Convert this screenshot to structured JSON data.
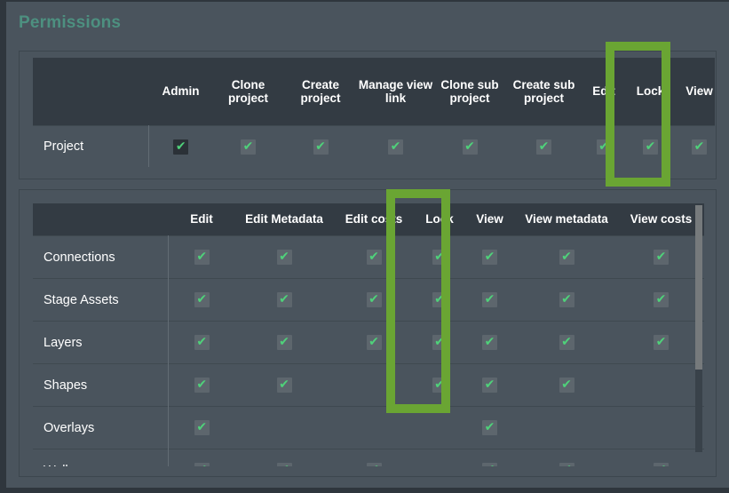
{
  "page": {
    "title": "Permissions",
    "title_color": "#4d9080",
    "background": "#4a545d",
    "header_background": "#333b43",
    "highlight_color": "#6aa533",
    "check_color": "#4fd17a"
  },
  "check_glyph": "✔",
  "project_table": {
    "row_header_label": "",
    "columns": [
      "Admin",
      "Clone project",
      "Create project",
      "Manage view link",
      "Clone sub project",
      "Create sub project",
      "Edit",
      "Lock",
      "View"
    ],
    "rows": [
      {
        "label": "Project",
        "cells": [
          true,
          true,
          true,
          true,
          true,
          true,
          true,
          true,
          true
        ],
        "focused_cell_index": 0
      }
    ]
  },
  "entity_table": {
    "row_header_label": "",
    "columns": [
      "Edit",
      "Edit Metadata",
      "Edit costs",
      "Lock",
      "View",
      "View metadata",
      "View costs"
    ],
    "rows": [
      {
        "label": "Connections",
        "cells": [
          true,
          true,
          true,
          true,
          true,
          true,
          true
        ]
      },
      {
        "label": "Stage Assets",
        "cells": [
          true,
          true,
          true,
          true,
          true,
          true,
          true
        ]
      },
      {
        "label": "Layers",
        "cells": [
          true,
          true,
          true,
          true,
          true,
          true,
          true
        ]
      },
      {
        "label": "Shapes",
        "cells": [
          true,
          true,
          false,
          true,
          true,
          true,
          false
        ]
      },
      {
        "label": "Overlays",
        "cells": [
          true,
          false,
          false,
          false,
          true,
          false,
          false
        ]
      },
      {
        "label": "Walls",
        "cells": [
          true,
          true,
          true,
          false,
          true,
          true,
          true
        ]
      }
    ]
  },
  "highlights": [
    {
      "name": "project-lock-column-highlight",
      "label": "Lock"
    },
    {
      "name": "entity-lock-column-highlight",
      "label": "Lock"
    }
  ],
  "scrollbar": {
    "name": "entity-table-vertical-scrollbar"
  }
}
